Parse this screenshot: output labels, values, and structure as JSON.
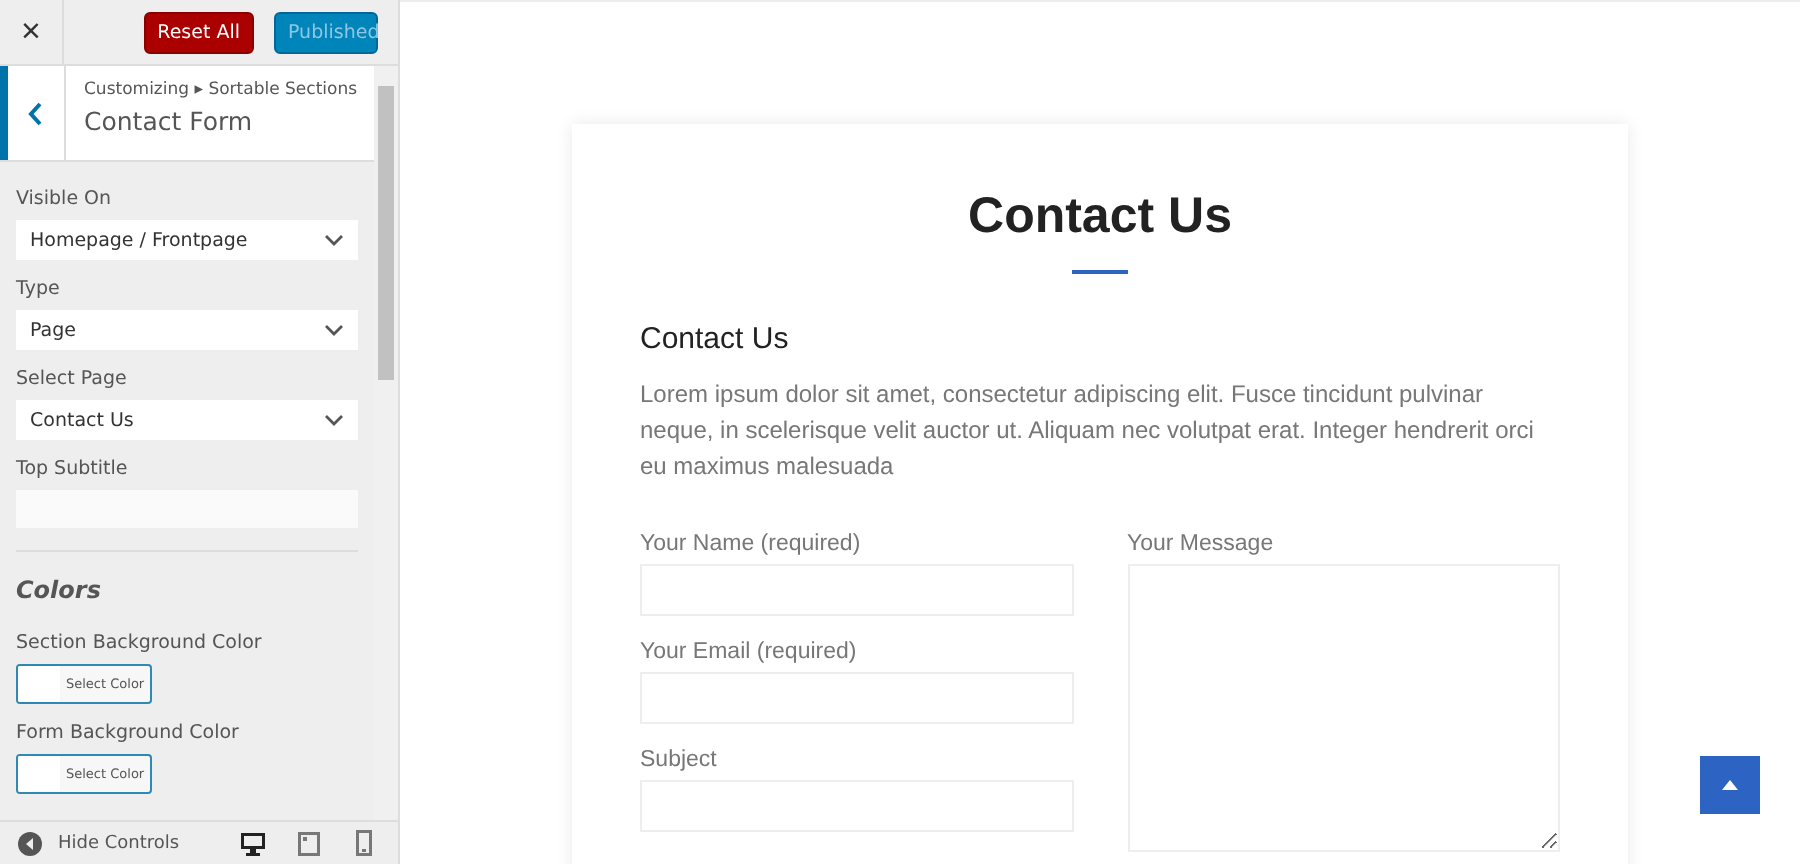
{
  "header": {
    "close": "×",
    "reset_button": "Reset All",
    "publish_button": {
      "label": "Published",
      "disabled": true
    }
  },
  "section": {
    "breadcrumb": "Customizing ▸ Sortable Sections",
    "title": "Contact Form"
  },
  "controls": [
    {
      "kind": "select",
      "label": "Visible On",
      "value": "Homepage / Frontpage"
    },
    {
      "kind": "select",
      "label": "Type",
      "value": "Page"
    },
    {
      "kind": "select",
      "label": "Select Page",
      "value": "Contact Us"
    },
    {
      "kind": "text",
      "label": "Top Subtitle"
    },
    {
      "kind": "heading",
      "label": "Colors"
    },
    {
      "kind": "color",
      "label": "Section Background Color",
      "button": "Select Color",
      "color": "#ffffff"
    },
    {
      "kind": "color",
      "label": "Form Background Color",
      "button": "Select Color",
      "color": "#ffffff"
    }
  ],
  "footer": {
    "hide_controls": "Hide Controls",
    "devices": [
      {
        "kind": "desktop",
        "selected": true
      },
      {
        "kind": "tablet",
        "selected": false
      },
      {
        "kind": "mobile",
        "selected": false
      }
    ]
  },
  "preview": {
    "title": "Contact Us",
    "subheading": "Contact Us",
    "intro": "Lorem ipsum dolor sit amet, consectetur adipiscing elit. Fusce tincidunt pulvinar neque, in scelerisque velit auctor ut. Aliquam nec volutpat erat. Integer hendrerit orci eu maximus malesuada",
    "fields": [
      {
        "label": "Your Name (required)"
      },
      {
        "label": "Your Email (required)"
      },
      {
        "label": "Subject"
      }
    ],
    "message_label": "Your Message"
  }
}
